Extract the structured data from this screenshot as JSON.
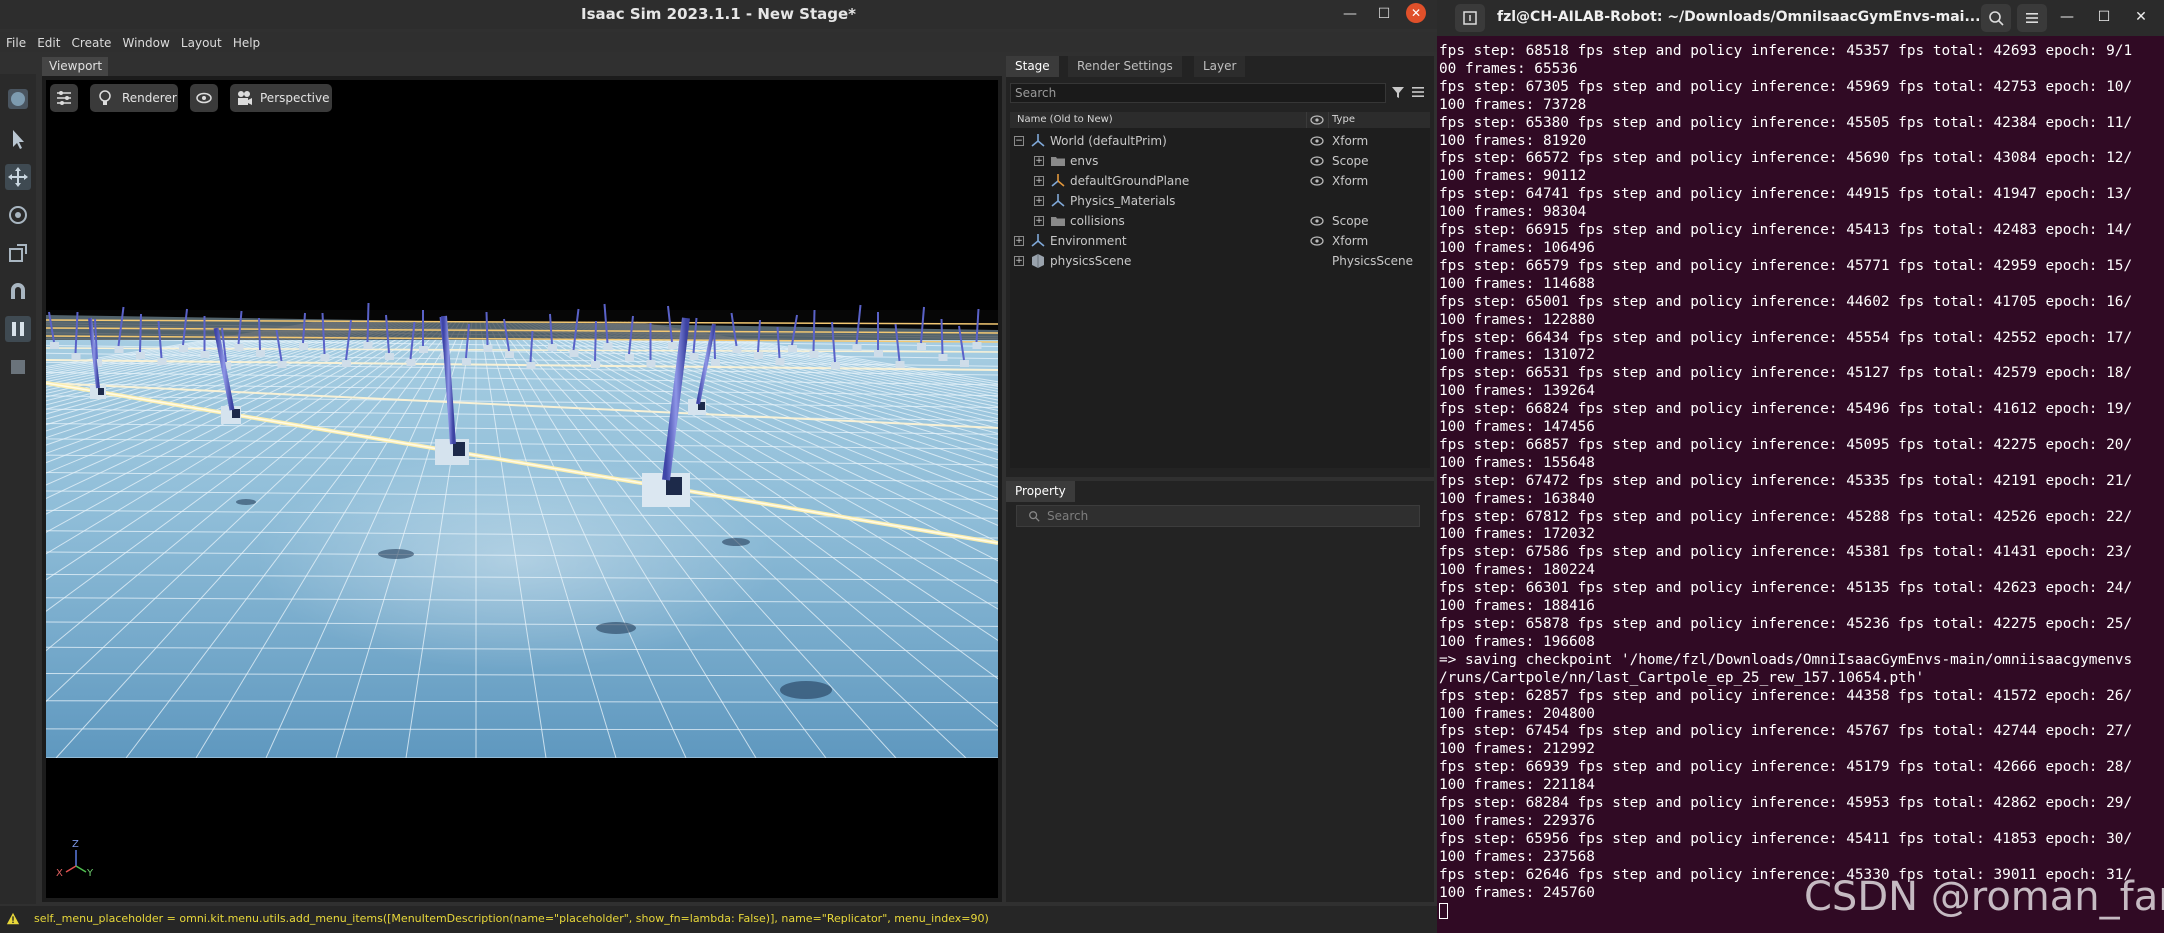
{
  "isaac": {
    "window_title": "Isaac Sim 2023.1.1 - New Stage*",
    "menu": [
      "File",
      "Edit",
      "Create",
      "Window",
      "Layout",
      "Help"
    ],
    "viewport_tab": "Viewport",
    "viewport_toolbar": {
      "renderer_label": "Renderer",
      "camera_label": "Perspective"
    },
    "axis_labels": {
      "z": "Z",
      "x": "X",
      "y": "Y"
    },
    "stage": {
      "tabs": [
        "Stage",
        "Render Settings",
        "Layer"
      ],
      "search_placeholder": "Search",
      "col_name": "Name (Old to New)",
      "col_type": "Type",
      "rows": [
        {
          "name": "World (defaultPrim)",
          "type": "Xform",
          "icon": "xform-icon",
          "expander": "−",
          "visible": true
        },
        {
          "name": "envs",
          "type": "Scope",
          "icon": "folder-icon",
          "expander": "+",
          "visible": true
        },
        {
          "name": "defaultGroundPlane",
          "type": "Xform",
          "icon": "xform-orange-icon",
          "expander": "+",
          "visible": true
        },
        {
          "name": "Physics_Materials",
          "type": "",
          "icon": "xform-icon",
          "expander": "+",
          "visible": false
        },
        {
          "name": "collisions",
          "type": "Scope",
          "icon": "folder-icon",
          "expander": "+",
          "visible": true
        },
        {
          "name": "Environment",
          "type": "Xform",
          "icon": "xform-icon",
          "expander": "+",
          "visible": true
        },
        {
          "name": "physicsScene",
          "type": "PhysicsScene",
          "icon": "physics-scene-icon",
          "expander": "+",
          "visible": false
        }
      ]
    },
    "property": {
      "tab": "Property",
      "search_placeholder": "Search"
    },
    "status": "self._menu_placeholder = omni.kit.menu.utils.add_menu_items([MenuItemDescription(name=\"placeholder\", show_fn=lambda: False)], name=\"Replicator\", menu_index=90)"
  },
  "terminal": {
    "title": "fzl@CH-AILAB-Robot: ~/Downloads/OmniIsaacGymEnvs-mai...",
    "lines": [
      "fps step: 68518 fps step and policy inference: 45357 fps total: 42693 epoch: 9/1",
      "00 frames: 65536",
      "fps step: 67305 fps step and policy inference: 45969 fps total: 42753 epoch: 10/",
      "100 frames: 73728",
      "fps step: 65380 fps step and policy inference: 45505 fps total: 42384 epoch: 11/",
      "100 frames: 81920",
      "fps step: 66572 fps step and policy inference: 45690 fps total: 43084 epoch: 12/",
      "100 frames: 90112",
      "fps step: 64741 fps step and policy inference: 44915 fps total: 41947 epoch: 13/",
      "100 frames: 98304",
      "fps step: 66915 fps step and policy inference: 45413 fps total: 42483 epoch: 14/",
      "100 frames: 106496",
      "fps step: 66579 fps step and policy inference: 45771 fps total: 42959 epoch: 15/",
      "100 frames: 114688",
      "fps step: 65001 fps step and policy inference: 44602 fps total: 41705 epoch: 16/",
      "100 frames: 122880",
      "fps step: 66434 fps step and policy inference: 45554 fps total: 42552 epoch: 17/",
      "100 frames: 131072",
      "fps step: 66531 fps step and policy inference: 45127 fps total: 42579 epoch: 18/",
      "100 frames: 139264",
      "fps step: 66824 fps step and policy inference: 45496 fps total: 41612 epoch: 19/",
      "100 frames: 147456",
      "fps step: 66857 fps step and policy inference: 45095 fps total: 42275 epoch: 20/",
      "100 frames: 155648",
      "fps step: 67472 fps step and policy inference: 45335 fps total: 42191 epoch: 21/",
      "100 frames: 163840",
      "fps step: 67812 fps step and policy inference: 45288 fps total: 42526 epoch: 22/",
      "100 frames: 172032",
      "fps step: 67586 fps step and policy inference: 45381 fps total: 41431 epoch: 23/",
      "100 frames: 180224",
      "fps step: 66301 fps step and policy inference: 45135 fps total: 42623 epoch: 24/",
      "100 frames: 188416",
      "fps step: 65878 fps step and policy inference: 45236 fps total: 42275 epoch: 25/",
      "100 frames: 196608",
      "=> saving checkpoint '/home/fzl/Downloads/OmniIsaacGymEnvs-main/omniisaacgymenvs",
      "/runs/Cartpole/nn/last_Cartpole_ep_25_rew_157.10654.pth'",
      "fps step: 62857 fps step and policy inference: 44358 fps total: 41572 epoch: 26/",
      "100 frames: 204800",
      "fps step: 67454 fps step and policy inference: 45767 fps total: 42744 epoch: 27/",
      "100 frames: 212992",
      "fps step: 66939 fps step and policy inference: 45179 fps total: 42666 epoch: 28/",
      "100 frames: 221184",
      "fps step: 68284 fps step and policy inference: 45953 fps total: 42862 epoch: 29/",
      "100 frames: 229376",
      "fps step: 65956 fps step and policy inference: 45411 fps total: 41853 epoch: 30/",
      "100 frames: 237568",
      "fps step: 62646 fps step and policy inference: 45330 fps total: 39011 epoch: 31/",
      "100 frames: 245760"
    ],
    "watermark": "CSDN @roman_fan"
  }
}
